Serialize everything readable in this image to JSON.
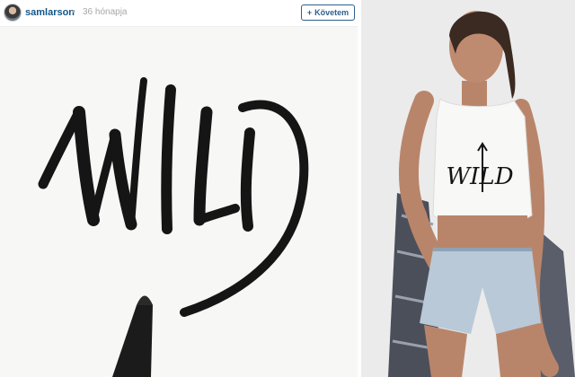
{
  "post": {
    "username": "samlarson",
    "separator": "•",
    "time": "36 hónapja",
    "follow_label": "Követem",
    "follow_icon": "plus-icon"
  },
  "artwork": {
    "lettering": "WILD"
  },
  "product": {
    "shirt_print": "WILD"
  },
  "colors": {
    "link": "#125688",
    "follow_border": "#2f5f8e",
    "muted": "#a5a7aa",
    "ink": "#111111"
  }
}
